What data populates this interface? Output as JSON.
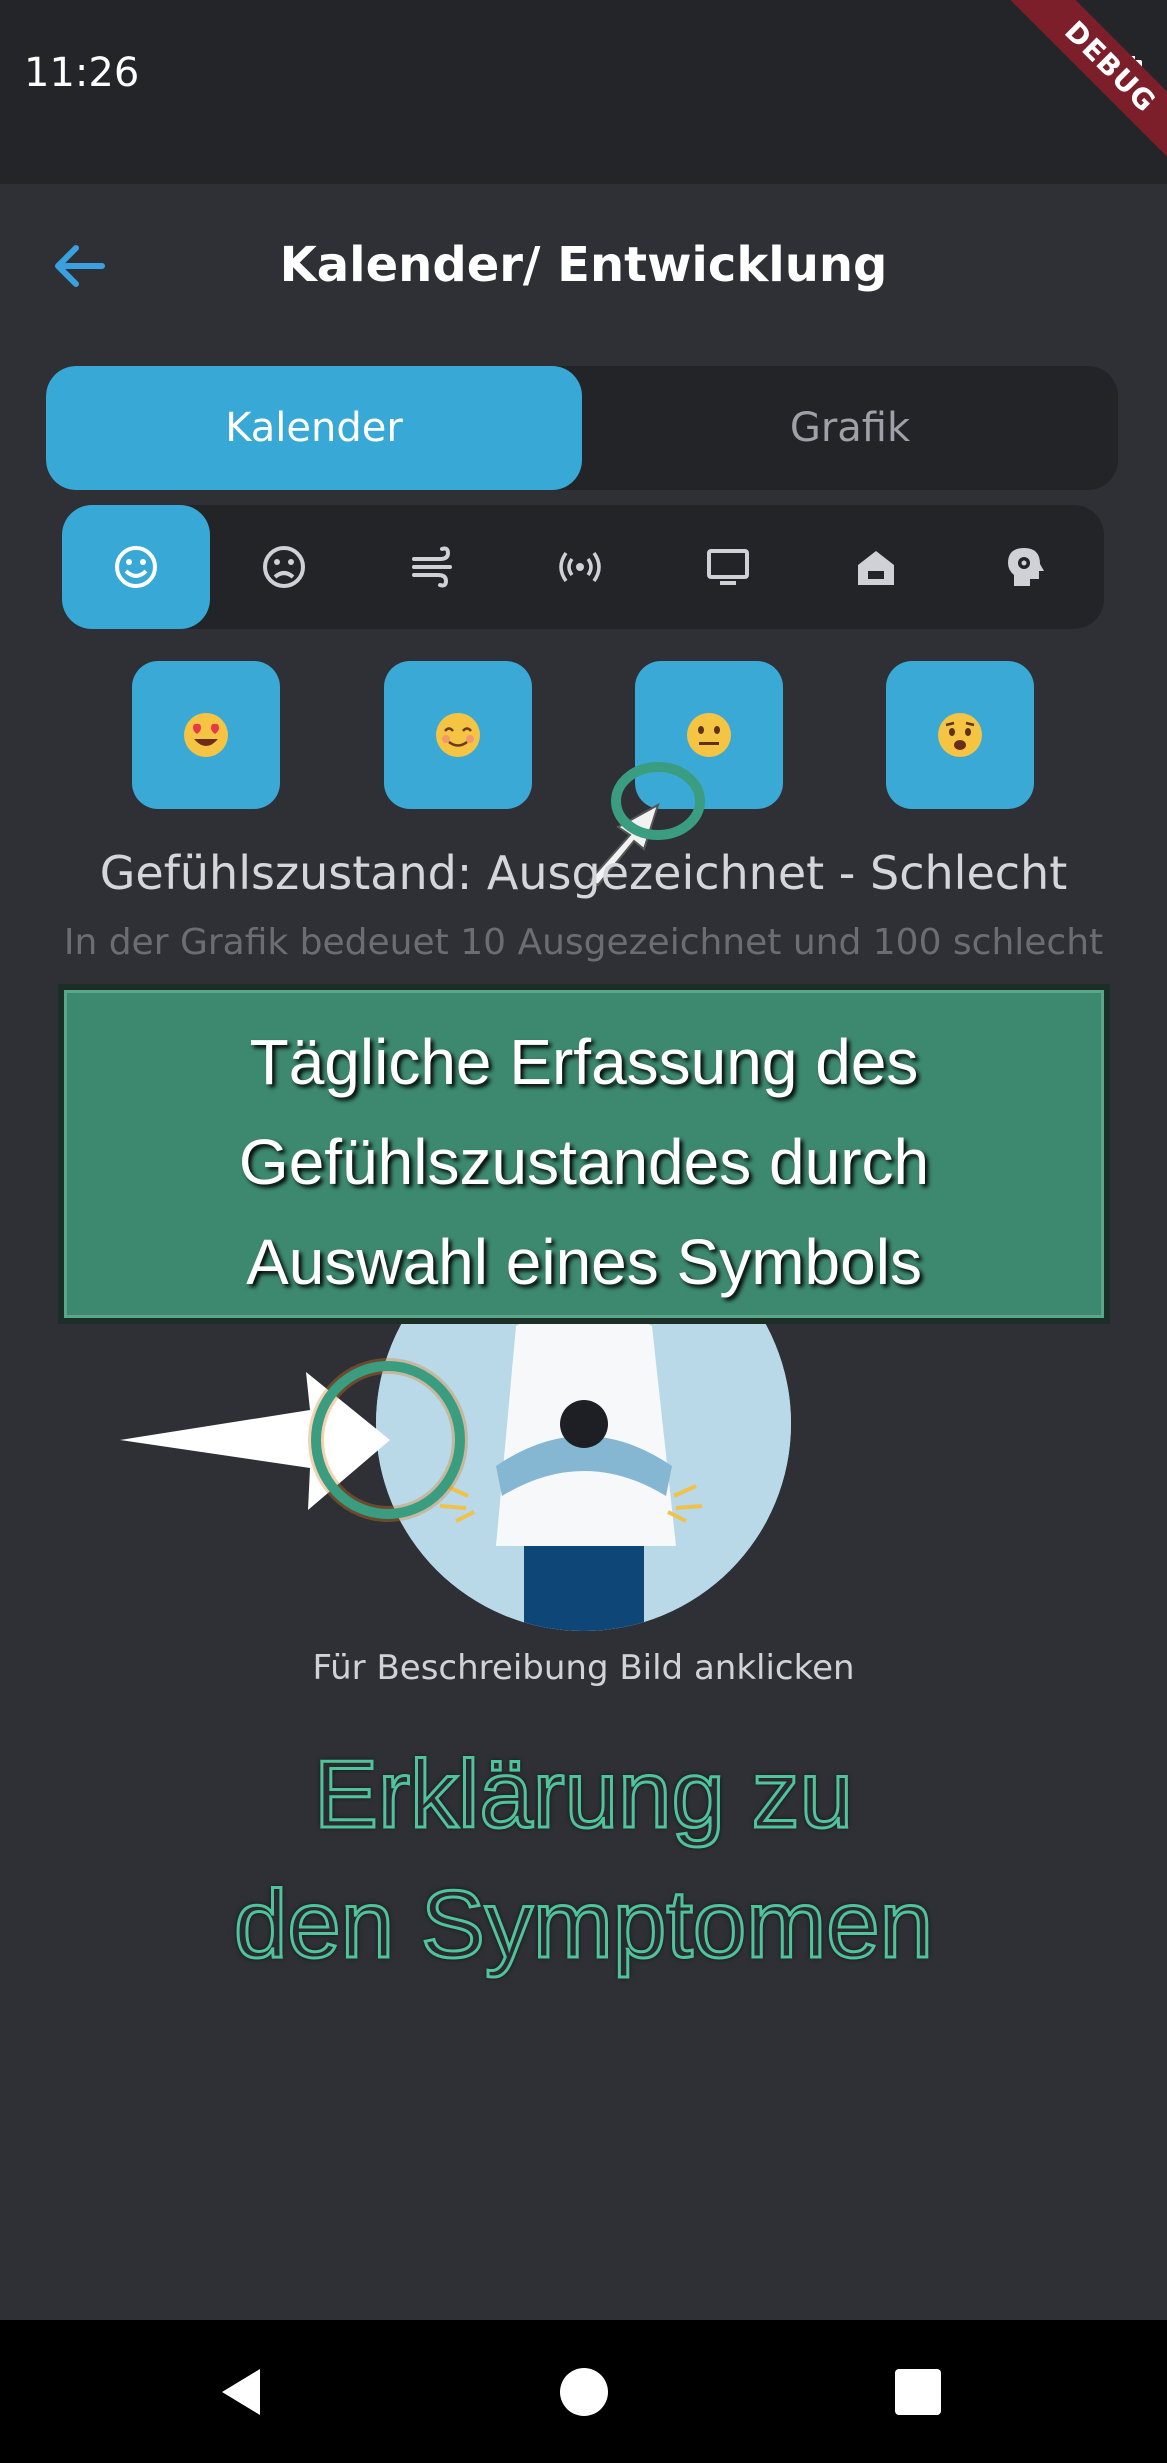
{
  "status_bar": {
    "time": "11:26",
    "battery_icon": "battery-full-icon"
  },
  "debug_banner": {
    "label": "DEBUG"
  },
  "app_bar": {
    "back_icon": "back-arrow-icon",
    "title": "Kalender/ Entwicklung"
  },
  "view_toggle": {
    "options": [
      "Kalender",
      "Grafik"
    ],
    "selected": "Kalender"
  },
  "symptom_tabs": {
    "selected_index": 0,
    "items": [
      {
        "icon": "smiley-happy-icon"
      },
      {
        "icon": "smiley-sad-icon"
      },
      {
        "icon": "wind-icon"
      },
      {
        "icon": "broadcast-icon"
      },
      {
        "icon": "monitor-icon"
      },
      {
        "icon": "home-icon"
      },
      {
        "icon": "head-gear-icon"
      }
    ]
  },
  "mood_options": [
    {
      "icon": "heart-eyes-emoji"
    },
    {
      "icon": "smiling-blush-emoji"
    },
    {
      "icon": "neutral-face-emoji"
    },
    {
      "icon": "anxious-face-emoji"
    }
  ],
  "mood_scale": {
    "label": "Gefühlszustand: Ausgezeichnet - Schlecht",
    "hint": "In der Grafik bedeuet 10 Ausgezeichnet und 100 schlecht"
  },
  "overlay_note": {
    "lines": [
      "Tägliche Erfassung des",
      "Gefühlszustandes durch",
      "Auswahl eines Symbols"
    ]
  },
  "illustration": {
    "icon": "person-arms-crossed-illustration"
  },
  "caption": "Für Beschreibung Bild anklicken",
  "heading": {
    "lines": [
      "Erklärung zu",
      "den Symptomen"
    ]
  },
  "colors": {
    "accent": "#38a8d6",
    "background": "#2f3036",
    "overlay_green": "#3d8970",
    "heading_outline": "#4fc39a"
  }
}
